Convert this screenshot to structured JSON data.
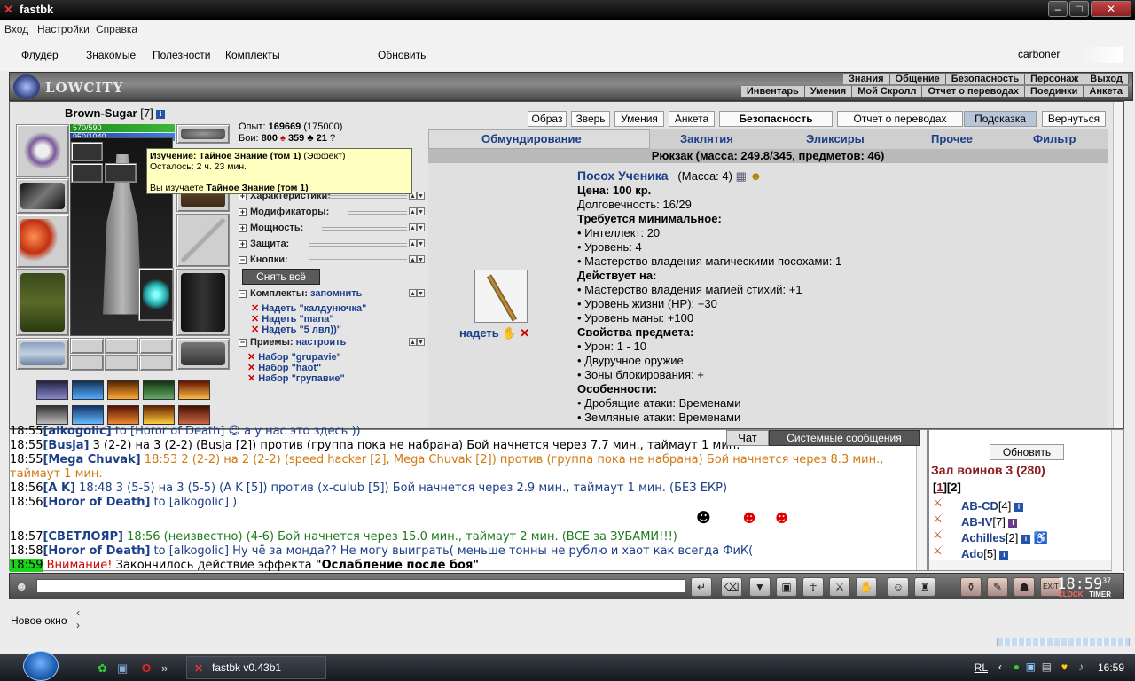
{
  "window": {
    "title": "fastbk",
    "app_icon": "crossed-swords-icon"
  },
  "menu": [
    "Вход",
    "Настройки",
    "Справка"
  ],
  "toolbar": {
    "items": [
      "Флудер",
      "Знакомые",
      "Полезности",
      "Комплекты",
      "Обновить"
    ],
    "login": "carboner"
  },
  "game_header": {
    "logo": "LOWCITY",
    "nav_top": [
      "Знания",
      "Общение",
      "Безопасность",
      "Персонаж",
      "Выход"
    ],
    "nav_bottom": [
      "Инвентарь",
      "Умения",
      "Мой Скролл",
      "Отчет о переводах",
      "Поединки",
      "Анкета"
    ]
  },
  "character": {
    "name": "Brown-Sugar",
    "level": "[7]",
    "hp": "570/590",
    "mana": "950/1040",
    "exp_label": "Опыт:",
    "exp": "169669",
    "exp_next": "(175000)",
    "fights_label": "Бои:",
    "wins": "800",
    "losses": "359",
    "draws": "21",
    "tooltip": {
      "line1_bold": "Изучение: Тайное Знание (том 1)",
      "line1_rest": "(Эффект)",
      "line2": "Осталось: 2 ч. 23 мин.",
      "line3_pre": "Вы изучаете",
      "line3_bold": "Тайное Знание (том 1)"
    },
    "sections": [
      "Характеристики:",
      "Модификаторы:",
      "Мощность:",
      "Защита:",
      "Кнопки:"
    ],
    "remove_all": "Снять всё",
    "sets_label": "Комплекты:",
    "sets_action": "запомнить",
    "sets": [
      "Надеть \"калдунючка\"",
      "Надеть \"mana\"",
      "Надеть \"5 лвл))\""
    ],
    "tricks_label": "Приемы:",
    "tricks_action": "настроить",
    "tricks": [
      "Набор \"grupavie\"",
      "Набор \"haot\"",
      "Набор \"групавие\""
    ]
  },
  "right_buttons": [
    "Образ",
    "Зверь",
    "Умения",
    "Анкета",
    "Безопасность",
    "Отчет о переводах",
    "Подсказка",
    "Вернуться"
  ],
  "inventory_tabs": [
    "Обмундирование",
    "Заклятия",
    "Эликсиры",
    "Прочее",
    "Фильтр"
  ],
  "backpack": "Рюкзак (масса: 249.8/345, предметов: 46)",
  "item": {
    "name": "Посох Ученика",
    "mass": "(Масса: 4)",
    "price": "Цена: 100 кр.",
    "durability": "Долговечность: 16/29",
    "req_title": "Требуется минимальное:",
    "reqs": [
      "• Интеллект: 20",
      "• Уровень: 4",
      "• Мастерство владения магическими посохами: 1"
    ],
    "effects_title": "Действует на:",
    "effects": [
      "• Мастерство владения магией стихий: +1",
      "• Уровень жизни (HP): +30",
      "• Уровень маны: +100"
    ],
    "props_title": "Свойства предмета:",
    "props": [
      "• Урон: 1 - 10",
      "• Двуручное оружие",
      "• Зоны блокирования: +"
    ],
    "features_title": "Особенности:",
    "features": [
      "• Дробящие атаки: Временами",
      "• Земляные атаки: Временами"
    ],
    "wear": "надеть"
  },
  "chat": {
    "tabs": [
      "Чат",
      "Системные сообщения"
    ],
    "lines": {
      "l0_time": "18:55",
      "l0_user": "[alkogolic]",
      "l0_text": "to [Horor of Death] ☺ а у нас это здесь ))",
      "l1_time": "18:55",
      "l1_user": "[Busja]",
      "l1_text": "3 (2-2) на 3 (2-2) (Busja [2]) против (группа пока не набрана) Бой начнется через 7.7 мин., таймаут 1 мин.",
      "l2_time": "18:55",
      "l2_user": "[Mega Chuvak]",
      "l2_text": "18:53 2 (2-2) на 2 (2-2) (speed hacker [2], Mega Chuvak [2]) против (группа пока не набрана) Бой начнется через 8.3 мин.,",
      "l2b_text": "таймаут 1 мин.",
      "l3_time": "18:56",
      "l3_user": "[A K]",
      "l3_text": "18:48 3 (5-5) на 3 (5-5) (A K [5]) против (x-culub [5]) Бой начнется через 2.9 мин., таймаут 1 мин. (БЕЗ ЕКР)",
      "l4_time": "18:56",
      "l4_user": "[Horor of Death]",
      "l4_text": "to [alkogolic] )",
      "l5_time": "18:57",
      "l5_user": "[СВЕТЛОЯР]",
      "l5_text": "18:56 (неизвестно) (4-6) Бой начнется через 15.0 мин., таймаут 2 мин. (ВСЕ за ЗУБАМИ!!!)",
      "l6_time": "18:58",
      "l6_user": "[Horor of Death]",
      "l6_text": "to [alkogolic] Ну чё за монда?? Не могу выиграть( меньше тонны не рублю и хаот как всегда ФиК(",
      "l7_time": "18:59",
      "l7_warn": "Внимание!",
      "l7_text": "Закончилось действие эффекта",
      "l7_bold": "\"Ослабление после боя\""
    }
  },
  "room": {
    "refresh": "Обновить",
    "title": "Зал воинов 3 (280)",
    "pages": [
      "1",
      "2"
    ],
    "players": [
      {
        "name": "AB-CD",
        "level": "[4]"
      },
      {
        "name": "AB-IV",
        "level": "[7]"
      },
      {
        "name": "Achilles",
        "level": "[2]"
      },
      {
        "name": "Ado",
        "level": "[5]"
      }
    ]
  },
  "clock": {
    "time": "18:59",
    "sec": "37",
    "clock_label": "CLOCK",
    "timer_label": "TIMER"
  },
  "bottom": {
    "new_window": "Новое окно"
  },
  "taskbar": {
    "task": "fastbk v0.43b1",
    "lang": "RL",
    "time": "16:59"
  },
  "colors": {
    "link": "#1c3f8a",
    "room_title": "#8a1c1c",
    "system_time_bg": "#19d419"
  }
}
